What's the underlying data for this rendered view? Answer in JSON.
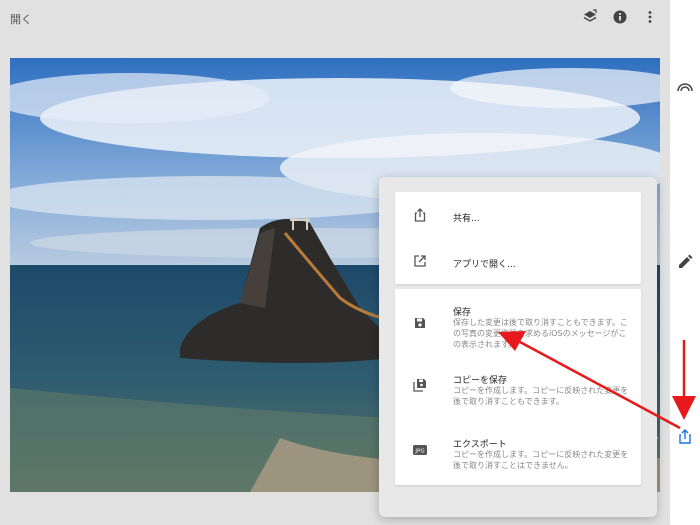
{
  "topbar": {
    "open_label": "開く"
  },
  "menu": {
    "share": {
      "title": "共有..."
    },
    "open_in_app": {
      "title": "アプリで開く..."
    },
    "save": {
      "title": "保存",
      "desc": "保存した変更は後で取り消すこともできます。この写真の変更権限を求めるiOSのメッセージがこの表示されます。"
    },
    "save_copy": {
      "title": "コピーを保存",
      "desc": "コピーを作成します。コピーに反映された変更を後で取り消すこともできます。"
    },
    "export": {
      "title": "エクスポート",
      "desc": "コピーを作成します。コピーに反映された変更を後で取り消すことはできません。",
      "icon_text": "JPG"
    }
  },
  "colors": {
    "annotation_arrow": "#e8191c",
    "accent_blue": "#1a73e8"
  },
  "icons": {
    "layers": "layers-icon",
    "info": "info-icon",
    "more": "more-vert-icon",
    "looks": "looks-icon",
    "edit": "pencil-icon",
    "share": "share-icon",
    "open_external": "open-external-icon",
    "save": "save-icon",
    "save_copy": "save-copy-icon",
    "export": "jpg-export-icon"
  }
}
